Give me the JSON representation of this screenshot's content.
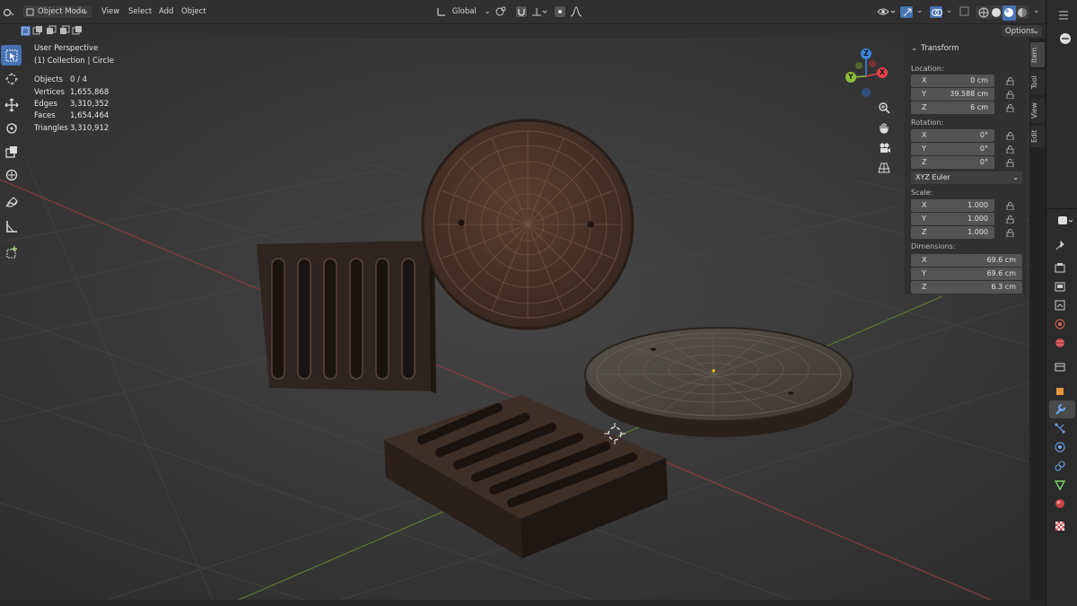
{
  "header": {
    "mode": "Object Mode",
    "menus": [
      "View",
      "Select",
      "Add",
      "Object"
    ],
    "orientation": "Global",
    "options_label": "Options"
  },
  "viewport_info": {
    "perspective": "User Perspective",
    "collection": "(1) Collection | Circle",
    "stats": [
      {
        "label": "Objects",
        "value": "0 / 4"
      },
      {
        "label": "Vertices",
        "value": "1,655,868"
      },
      {
        "label": "Edges",
        "value": "3,310,352"
      },
      {
        "label": "Faces",
        "value": "1,654,464"
      },
      {
        "label": "Triangles",
        "value": "3,310,912"
      }
    ]
  },
  "gizmo": {
    "x": "X",
    "y": "Y",
    "z": "Z"
  },
  "npanel": {
    "title": "Transform",
    "location_label": "Location:",
    "location": [
      {
        "axis": "X",
        "value": "0 cm"
      },
      {
        "axis": "Y",
        "value": "39.588 cm"
      },
      {
        "axis": "Z",
        "value": "6 cm"
      }
    ],
    "rotation_label": "Rotation:",
    "rotation": [
      {
        "axis": "X",
        "value": "0°"
      },
      {
        "axis": "Y",
        "value": "0°"
      },
      {
        "axis": "Z",
        "value": "0°"
      }
    ],
    "rotation_mode": "XYZ Euler",
    "scale_label": "Scale:",
    "scale": [
      {
        "axis": "X",
        "value": "1.000"
      },
      {
        "axis": "Y",
        "value": "1.000"
      },
      {
        "axis": "Z",
        "value": "1.000"
      }
    ],
    "dimensions_label": "Dimensions:",
    "dimensions": [
      {
        "axis": "X",
        "value": "69.6 cm"
      },
      {
        "axis": "Y",
        "value": "69.6 cm"
      },
      {
        "axis": "Z",
        "value": "6.3 cm"
      }
    ]
  },
  "side_tabs": [
    "Item",
    "Tool",
    "View",
    "Edit"
  ],
  "colors": {
    "accent": "#4772b3",
    "x_axis": "#e5424e",
    "y_axis": "#8cc036",
    "z_axis": "#3a84d9"
  }
}
